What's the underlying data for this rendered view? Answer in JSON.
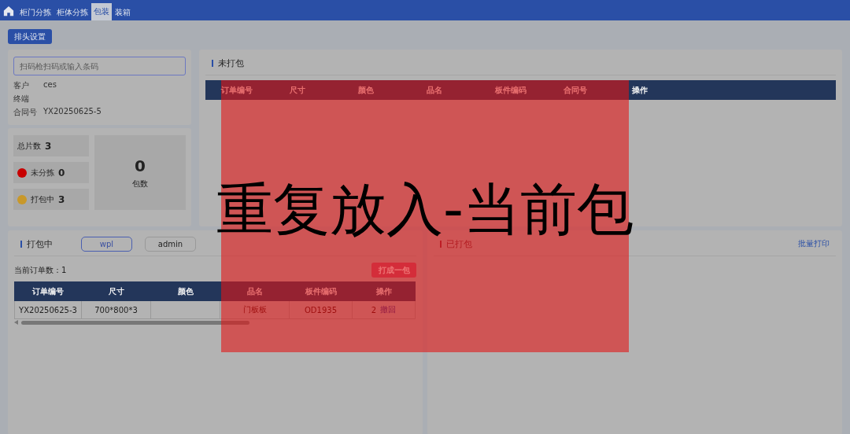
{
  "nav": {
    "tabs": [
      {
        "label": "柜门分拣",
        "selected": false
      },
      {
        "label": "柜体分拣",
        "selected": false
      },
      {
        "label": "包装",
        "selected": true
      },
      {
        "label": "装箱",
        "selected": false
      }
    ]
  },
  "toolbar": {
    "button": "排头设置"
  },
  "scan": {
    "placeholder": "扫码枪扫码或输入条码",
    "info": [
      {
        "label": "客户",
        "value": "ces"
      },
      {
        "label": "终端"
      },
      {
        "label": "合同号",
        "value": "YX20250625-5"
      }
    ],
    "stats": [
      {
        "kind": "plain",
        "label": "总片数",
        "value": "3"
      },
      {
        "kind": "dot",
        "label": "未分拣",
        "value": "0",
        "color": "#c80000"
      },
      {
        "kind": "dot",
        "label": "打包中",
        "value": "3",
        "color": "#c8982a"
      }
    ],
    "packages": {
      "value": "0",
      "label": "包数"
    }
  },
  "unpacked": {
    "title": "未打包",
    "columns": [
      "订单编号",
      "尺寸",
      "颜色",
      "品名",
      "板件编码",
      "合同号",
      "操作"
    ]
  },
  "packing": {
    "title": "打包中",
    "users": [
      {
        "label": "wpl",
        "selected": true
      },
      {
        "label": "admin",
        "selected": false
      }
    ],
    "order_count": "当前订单数：1",
    "button": "打成一包",
    "columns": [
      "订单编号",
      "尺寸",
      "颜色",
      "品名",
      "板件编码",
      "操作"
    ],
    "rows": [
      {
        "cells": [
          "YX20250625-3",
          "700*800*3",
          "",
          "门板板",
          "OD1935"
        ],
        "count": "2",
        "action": "撤回"
      }
    ]
  },
  "packed": {
    "title": "已打包",
    "action": "批量打印"
  },
  "dialog": {
    "message": "重复放入-当前包"
  }
}
